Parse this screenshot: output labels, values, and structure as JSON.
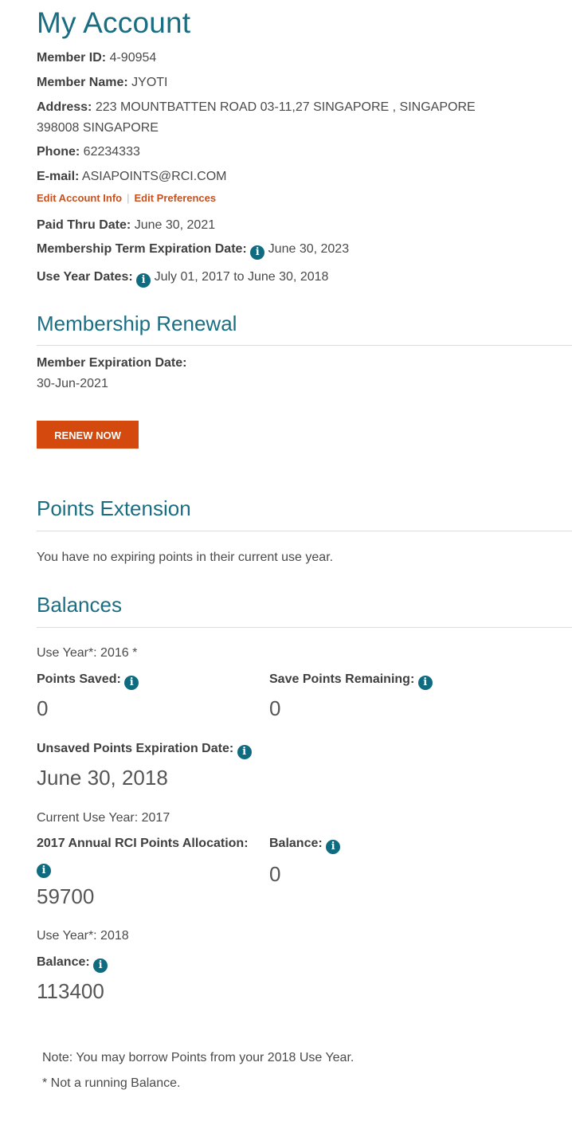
{
  "page_title": "My Account",
  "account": {
    "member_id_label": "Member ID:",
    "member_id": "4-90954",
    "member_name_label": "Member Name:",
    "member_name": "JYOTI",
    "address_label": "Address:",
    "address_line1": "223 MOUNTBATTEN ROAD 03-11,27 SINGAPORE , SINGAPORE",
    "address_line2": "398008 SINGAPORE",
    "phone_label": "Phone:",
    "phone": "62234333",
    "email_label": "E-mail:",
    "email": "ASIAPOINTS@RCI.COM",
    "edit_account_link": "Edit Account Info",
    "link_separator": "|",
    "edit_preferences_link": "Edit Preferences",
    "paid_thru_label": "Paid Thru Date:",
    "paid_thru": "June 30, 2021",
    "term_expiration_label": "Membership Term Expiration Date:",
    "term_expiration": "June 30, 2023",
    "use_year_dates_label": "Use Year Dates:",
    "use_year_dates": "July 01, 2017 to June 30, 2018"
  },
  "icons": {
    "info": "i"
  },
  "renewal": {
    "heading": "Membership Renewal",
    "expiration_label": "Member Expiration Date:",
    "expiration_value": "30-Jun-2021",
    "renew_button": "RENEW NOW"
  },
  "extension": {
    "heading": "Points Extension",
    "message": "You have no expiring points in their current use year."
  },
  "balances": {
    "heading": "Balances",
    "use_year_2016": "Use Year*: 2016 *",
    "points_saved_label": "Points Saved:",
    "points_saved": "0",
    "save_remaining_label": "Save Points Remaining:",
    "save_remaining": "0",
    "unsaved_exp_label": "Unsaved Points Expiration Date:",
    "unsaved_exp": "June 30, 2018",
    "current_use_year": "Current Use Year: 2017",
    "allocation_label": "2017 Annual RCI Points Allocation:",
    "allocation": "59700",
    "balance_label": "Balance:",
    "balance_2017": "0",
    "use_year_2018": "Use Year*: 2018",
    "balance_2018_label": "Balance:",
    "balance_2018": "113400",
    "note": "Note: You may borrow Points from your 2018 Use Year.",
    "footnote": "* Not a running Balance."
  },
  "colors": {
    "heading": "#1b6e82",
    "accent": "#d4490d",
    "link": "#c9501c",
    "info_icon": "#0f6b80"
  }
}
